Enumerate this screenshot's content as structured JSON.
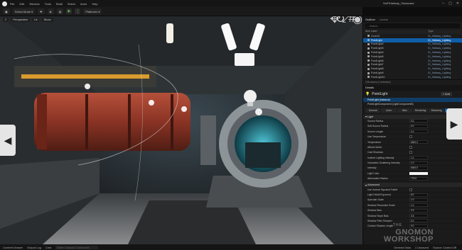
{
  "menu": {
    "items": [
      "File",
      "Edit",
      "Window",
      "Tools",
      "Build",
      "Select",
      "Actor",
      "Help"
    ],
    "tab_title": "SciFiHallway_Showcase"
  },
  "toolbar": {
    "mode": "Select Mode",
    "platforms": "Platforms",
    "settings": "Settings"
  },
  "viewport": {
    "perspective": "Perspective",
    "lit": "Lit",
    "show": "Show"
  },
  "outliner": {
    "tab_active": "Outliner",
    "tab_other": "Levels",
    "search_placeholder": "Search...",
    "col_label": "Item Label",
    "col_type": "Type",
    "rows": [
      {
        "label": "Cone10",
        "type": "01_Hallway_Lighting",
        "sel": false
      },
      {
        "label": "PointLight",
        "type": "01_Hallway_Lighting",
        "sel": true
      },
      {
        "label": "PointLight2",
        "type": "01_Hallway_Lighting",
        "sel": false
      },
      {
        "label": "PointLight3",
        "type": "01_Hallway_Lighting",
        "sel": false
      },
      {
        "label": "PointLight4",
        "type": "01_Hallway_Lighting",
        "sel": false
      },
      {
        "label": "PointLight5",
        "type": "01_Hallway_Lighting",
        "sel": false
      },
      {
        "label": "PointLight6",
        "type": "01_Hallway_Lighting",
        "sel": false
      },
      {
        "label": "PointLight7",
        "type": "01_Hallway_Lighting",
        "sel": false
      },
      {
        "label": "PointLight8",
        "type": "01_Hallway_Lighting",
        "sel": false
      },
      {
        "label": "PointLight9",
        "type": "01_Hallway_Lighting",
        "sel": false
      },
      {
        "label": "PointLight10",
        "type": "01_Hallway_Lighting",
        "sel": false
      }
    ],
    "count": "135 actors (1 selected)"
  },
  "details": {
    "tab": "Details",
    "actor": "PointLight",
    "add": "+ Add",
    "components": [
      {
        "label": "PointLight (Instance)",
        "sel": true
      },
      {
        "label": "PointLightComponent (LightComponent0)",
        "sel": false
      }
    ],
    "filters": [
      "General",
      "Actor",
      "Misc",
      "Rendering",
      "Streaming",
      "All"
    ],
    "section_light": "Light",
    "props": [
      {
        "label": "Source Radius",
        "value": "0.0"
      },
      {
        "label": "Soft Source Radius",
        "value": "0.0"
      },
      {
        "label": "Source Length",
        "value": "0.0"
      },
      {
        "label": "Use Temperature",
        "value": ""
      },
      {
        "label": "Temperature",
        "value": "6500.0"
      },
      {
        "label": "Affects World",
        "value": ""
      },
      {
        "label": "Cast Shadows",
        "value": ""
      },
      {
        "label": "Indirect Lighting Intensity",
        "value": "1.0"
      },
      {
        "label": "Volumetric Scattering Intensity",
        "value": "1.0"
      },
      {
        "label": "Intensity",
        "value": "5000.0"
      },
      {
        "label": "Light Color",
        "value": ""
      },
      {
        "label": "Attenuation Radius",
        "value": "775.6"
      }
    ],
    "section_adv": "Advanced",
    "props2": [
      {
        "label": "Use Inverse Squared Falloff",
        "value": ""
      },
      {
        "label": "Light Falloff Exponent",
        "value": "8.0"
      },
      {
        "label": "Specular Scale",
        "value": "1.0"
      },
      {
        "label": "Shadow Resolution Scale",
        "value": "1.0"
      },
      {
        "label": "Shadow Bias",
        "value": "0.5"
      },
      {
        "label": "Shadow Slope Bias",
        "value": "0.5"
      },
      {
        "label": "Shadow Filter Sharpen",
        "value": "0.0"
      },
      {
        "label": "Contact Shadow Length",
        "value": "0.0"
      }
    ]
  },
  "bottom": {
    "content_browser": "Content Drawer",
    "output_log": "Output Log",
    "cmd": "Cmd",
    "cmd_placeholder": "Enter Console Command",
    "derived": "Derived Data",
    "unsaved": "1 Unsaved",
    "source_control": "Source Control Off"
  },
  "watermark": {
    "small": "THE",
    "big1": "GNOMON",
    "big2": "WORKSHOP"
  },
  "colors": {
    "accent": "#0f5ea8",
    "bg": "#1b1b1b",
    "light_color": "#f4f4f4"
  }
}
